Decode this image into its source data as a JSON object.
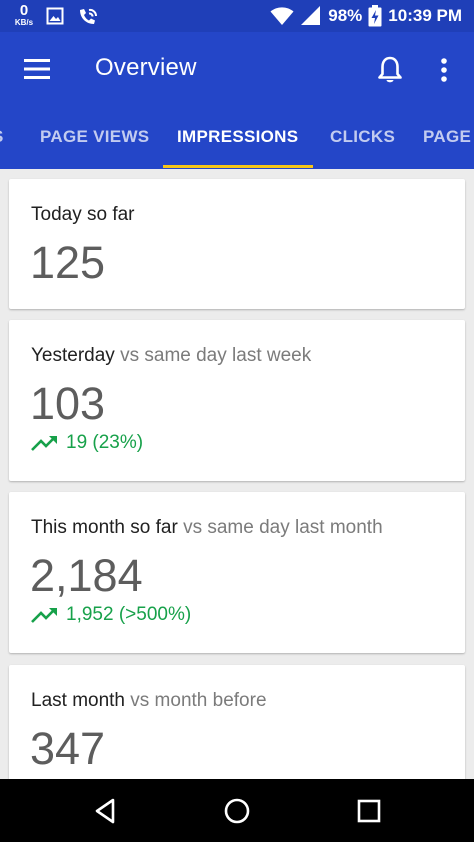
{
  "status_bar": {
    "speed_value": "0",
    "speed_unit": "KB/s",
    "battery": "98%",
    "time": "10:39 PM"
  },
  "app_bar": {
    "title": "Overview"
  },
  "tabs": [
    {
      "label": "S"
    },
    {
      "label": "PAGE VIEWS"
    },
    {
      "label": "IMPRESSIONS"
    },
    {
      "label": "CLICKS"
    },
    {
      "label": "PAGE"
    }
  ],
  "cards": [
    {
      "title": "Today so far",
      "comparison": "",
      "value": "125",
      "trend": ""
    },
    {
      "title": "Yesterday",
      "comparison": "vs same day last week",
      "value": "103",
      "trend": "19 (23%)"
    },
    {
      "title": "This month so far",
      "comparison": "vs same day last month",
      "value": "2,184",
      "trend": "1,952 (>500%)"
    },
    {
      "title": "Last month",
      "comparison": "vs month before",
      "value": "347",
      "trend": ""
    }
  ],
  "colors": {
    "app_bar": "#2446c8",
    "status_bar": "#1f3fb8",
    "tab_indicator": "#f5c518",
    "trend_up": "#17a14a"
  }
}
